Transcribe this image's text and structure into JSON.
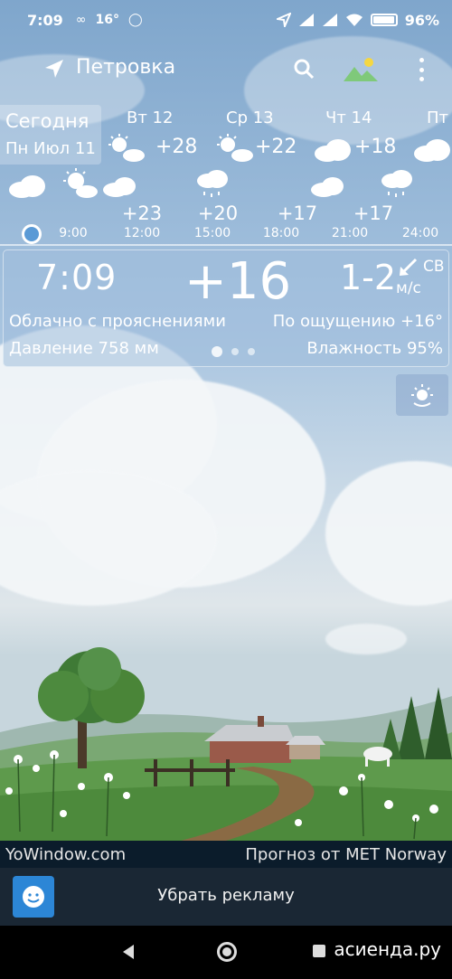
{
  "status_bar": {
    "time": "7:09",
    "temp": "16°",
    "battery": "96%",
    "battery_level": 0.96,
    "icons": [
      "link-icon",
      "whatsapp-icon",
      "location-arrow-icon",
      "signal-icon",
      "signal-icon",
      "wifi-icon",
      "battery-icon"
    ]
  },
  "header": {
    "city": "Петровка",
    "icons": [
      "location-arrow-icon",
      "search-icon",
      "landscape-icon",
      "more-vert-icon"
    ]
  },
  "daily": {
    "today_label": "Сегодня",
    "today_date": "Пн Июл 11",
    "days": [
      {
        "name": "Вт 12",
        "temp": "+28",
        "icon": "sun-cloud-icon"
      },
      {
        "name": "Ср 13",
        "temp": "+22",
        "icon": "sun-cloud-icon"
      },
      {
        "name": "Чт 14",
        "temp": "+18",
        "icon": "cloud-icon"
      },
      {
        "name": "Пт",
        "temp": "",
        "icon": "cloud-icon"
      }
    ]
  },
  "hourly": {
    "temps": [
      "+23",
      "+20",
      "+17",
      "+17"
    ],
    "times": [
      "9:00",
      "12:00",
      "15:00",
      "18:00",
      "21:00",
      "24:00"
    ],
    "icons": [
      "cloud-icon",
      "sun-cloud-icon",
      "cloud-icon",
      "rain-cloud-icon",
      "cloud-icon",
      "rain-cloud-icon"
    ]
  },
  "current": {
    "time": "7:09",
    "temp": "+16",
    "wind": "1-2",
    "wind_dir": "СВ",
    "wind_unit": "м/с",
    "description": "Облачно с прояснениями",
    "feels_like": "По ощущению +16°",
    "pressure": "Давление 758 мм",
    "humidity": "Влажность 95%"
  },
  "footer": {
    "site": "YoWindow.com",
    "source": "Прогноз от MET Norway",
    "remove_ads": "Убрать рекламу",
    "watermark": "асиенда.ру"
  },
  "colors": {
    "accent_blue": "#2c86d6",
    "credits_bg": "#0b1c2b",
    "ad_bg": "#1a2734"
  }
}
